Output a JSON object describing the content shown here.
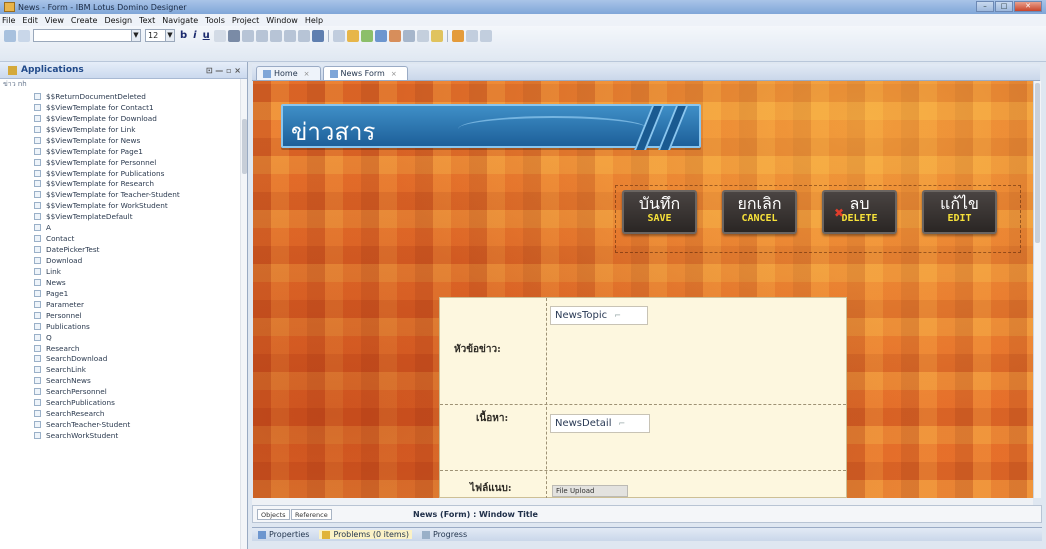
{
  "window": {
    "title": "News - Form - IBM Lotus Domino Designer",
    "buttons": [
      "–",
      "□",
      "✕"
    ]
  },
  "menu": [
    "File",
    "Edit",
    "View",
    "Create",
    "Design",
    "Text",
    "Navigate",
    "Tools",
    "Project",
    "Window",
    "Help"
  ],
  "toolbar": {
    "font_size": "12",
    "bold_label": "b",
    "italic_label": "i",
    "underline_label": "u"
  },
  "applications_panel": {
    "title": "Applications",
    "subtitle": "ข่าว nh",
    "items": [
      "$$ReturnDocumentDeleted",
      "$$ViewTemplate for Contact1",
      "$$ViewTemplate for Download",
      "$$ViewTemplate for Link",
      "$$ViewTemplate for News",
      "$$ViewTemplate for Page1",
      "$$ViewTemplate for Personnel",
      "$$ViewTemplate for Publications",
      "$$ViewTemplate for Research",
      "$$ViewTemplate for Teacher-Student",
      "$$ViewTemplate for WorkStudent",
      "$$ViewTemplateDefault",
      "A",
      "Contact",
      "DatePickerTest",
      "Download",
      "Link",
      "News",
      "Page1",
      "Parameter",
      "Personnel",
      "Publications",
      "Q",
      "Research",
      "SearchDownload",
      "SearchLink",
      "SearchNews",
      "SearchPersonnel",
      "SearchPublications",
      "SearchResearch",
      "SearchTeacher-Student",
      "SearchWorkStudent"
    ]
  },
  "editor_tabs": [
    {
      "label": "Home",
      "active": false
    },
    {
      "label": "News  Form",
      "active": true
    }
  ],
  "form": {
    "banner_title": "ข่าวสาร",
    "buttons": [
      {
        "thai": "บันทึก",
        "english": "SAVE"
      },
      {
        "thai": "ยกเลิก",
        "english": "CANCEL"
      },
      {
        "thai": "ลบ",
        "english": "DELETE"
      },
      {
        "thai": "แก้ไข",
        "english": "EDIT"
      }
    ],
    "fields": [
      {
        "label": "หัวข้อข่าว:",
        "field": "NewsTopic"
      },
      {
        "label": "เนื้อหา:",
        "field": "NewsDetail"
      },
      {
        "label": "ไฟล์แนบ:",
        "field": "File Upload"
      }
    ]
  },
  "bottom": {
    "objects_tab": "Objects",
    "reference_tab": "Reference",
    "window_title": "News (Form) : Window Title"
  },
  "status_tabs": [
    {
      "label": "Properties"
    },
    {
      "label": "Problems (0 items)"
    },
    {
      "label": "Progress"
    }
  ],
  "colors": {
    "banner_blue": "#2a74b4",
    "button_dark": "#3a3432",
    "button_accent_yellow": "#f7e23a",
    "canvas_orange": "#e8752f",
    "form_bg": "#fdf7df"
  }
}
